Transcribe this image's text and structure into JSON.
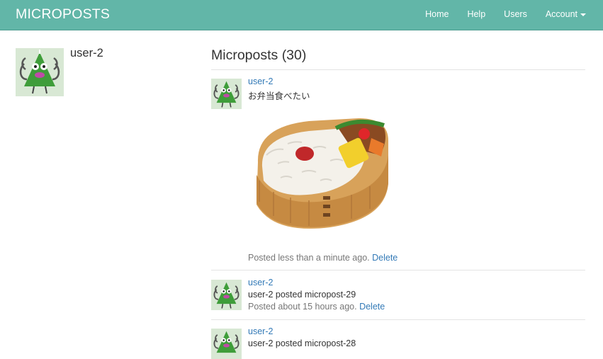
{
  "navbar": {
    "brand": "MICROPOSTS",
    "links": {
      "home": "Home",
      "help": "Help",
      "users": "Users",
      "account": "Account"
    }
  },
  "profile": {
    "name": "user-2"
  },
  "feed": {
    "title": "Microposts (30)",
    "posts": [
      {
        "user": "user-2",
        "content": "お弁当食べたい",
        "posted": "Posted less than a minute ago.",
        "delete": "Delete"
      },
      {
        "user": "user-2",
        "content": "user-2 posted micropost-29",
        "posted": "Posted about 15 hours ago.",
        "delete": "Delete"
      },
      {
        "user": "user-2",
        "content": "user-2 posted micropost-28",
        "posted": "",
        "delete": ""
      }
    ]
  },
  "colors": {
    "navbar": "#62b6a8",
    "link": "#337ab7"
  }
}
